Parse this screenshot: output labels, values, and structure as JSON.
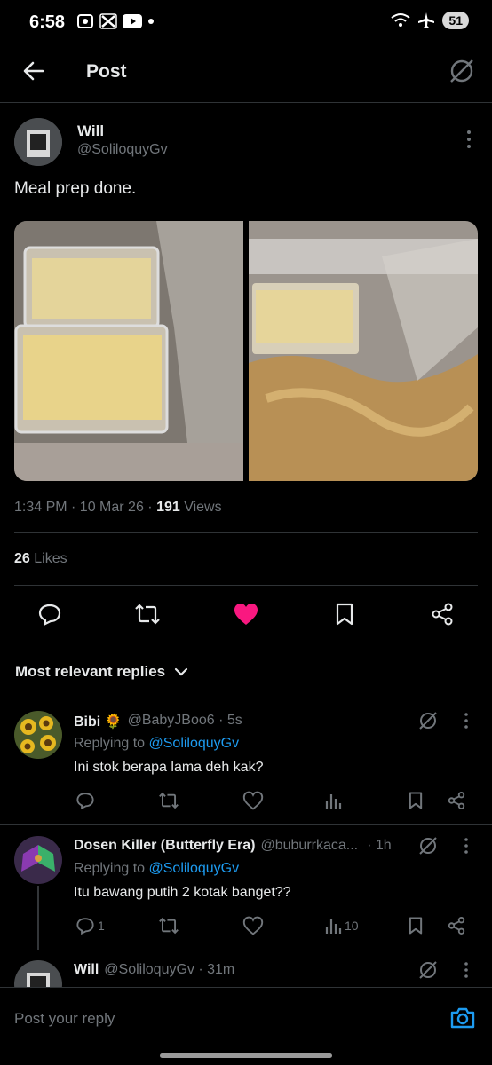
{
  "status_bar": {
    "time": "6:58",
    "battery": "51"
  },
  "header": {
    "title": "Post"
  },
  "tweet": {
    "author_name": "Will",
    "author_handle": "@SoliloquyGv",
    "text": "Meal prep done.",
    "timestamp": "1:34 PM · 10 Mar 26 · ",
    "views_count": "191",
    "views_label": " Views",
    "likes_count": "26",
    "likes_label": " Likes"
  },
  "sort_label": "Most relevant replies",
  "replies": [
    {
      "name": "Bibi 🌻",
      "handle": "@BabyJBoo6 · 5s",
      "replying_prefix": "Replying to ",
      "replying_to": "@SoliloquyGv",
      "text": "Ini stok berapa lama deh kak?",
      "reply_count": "",
      "views_count": ""
    },
    {
      "name": "Dosen Killer (Butterfly Era)",
      "handle": "@buburrkaca...",
      "time": "· 1h",
      "replying_prefix": "Replying to ",
      "replying_to": "@SoliloquyGv",
      "text": "Itu bawang putih 2 kotak banget??",
      "reply_count": "1",
      "views_count": "10"
    },
    {
      "name": "Will",
      "handle": "@SoliloquyGv · 31m"
    }
  ],
  "reply_bar": {
    "placeholder": "Post your reply"
  },
  "colors": {
    "accent": "#1d9bf0",
    "like": "#f91880",
    "muted": "#71767b",
    "background": "#000000"
  }
}
